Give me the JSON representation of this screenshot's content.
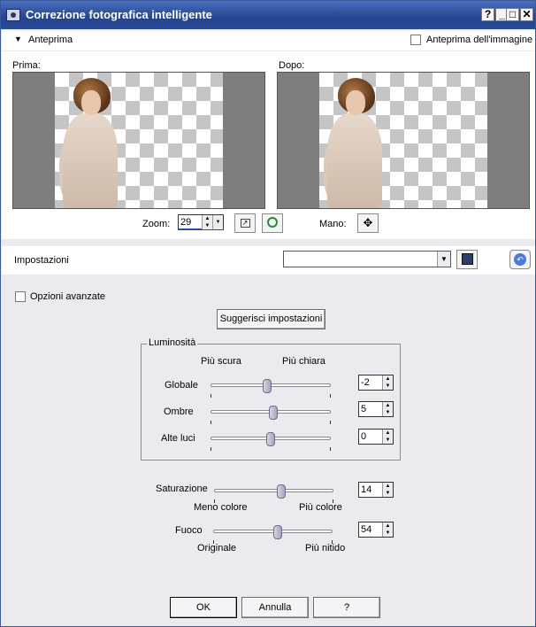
{
  "window": {
    "title": "Correzione fotografica intelligente"
  },
  "preview": {
    "toggle_label": "Anteprima",
    "image_preview_label": "Anteprima dell'immagine",
    "before_label": "Prima:",
    "after_label": "Dopo:"
  },
  "zoom": {
    "label": "Zoom:",
    "value": "29",
    "pan_label": "Mano:"
  },
  "settings": {
    "label": "Impostazioni",
    "preset_value": ""
  },
  "advanced": {
    "label": "Opzioni avanzate",
    "suggest_button": "Suggerisci impostazioni"
  },
  "brightness": {
    "group_title": "Luminosità",
    "darker_label": "Più scura",
    "brighter_label": "Più chiara",
    "rows": [
      {
        "label": "Globale",
        "value": "-2",
        "level": 0.47
      },
      {
        "label": "Ombre",
        "value": "5",
        "level": 0.52
      },
      {
        "label": "Alte luci",
        "value": "0",
        "level": 0.5
      }
    ]
  },
  "saturation": {
    "label": "Saturazione",
    "value": "14",
    "level": 0.57,
    "min_label": "Meno colore",
    "max_label": "Più colore"
  },
  "focus": {
    "label": "Fuoco",
    "value": "54",
    "level": 0.54,
    "min_label": "Originale",
    "max_label": "Più nitido"
  },
  "buttons": {
    "ok": "OK",
    "cancel": "Annulla",
    "help": "?"
  },
  "colors": {
    "titlebar": "#2a4a9a",
    "background": "#ebeaee"
  }
}
